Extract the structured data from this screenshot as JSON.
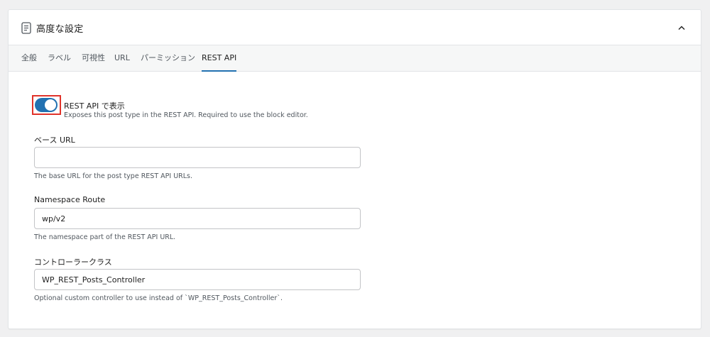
{
  "panel": {
    "title": "高度な設定",
    "header_icon": "document-icon",
    "collapse_icon": "chevron-up-icon"
  },
  "tabs": [
    {
      "label": "全般",
      "active": false
    },
    {
      "label": "ラベル",
      "active": false
    },
    {
      "label": "可視性",
      "active": false
    },
    {
      "label": "URL",
      "active": false
    },
    {
      "label": "パーミッション",
      "active": false
    },
    {
      "label": "REST API",
      "active": true
    }
  ],
  "rest_toggle": {
    "label": "REST API で表示",
    "help": "Exposes this post type in the REST API. Required to use the block editor.",
    "checked": true
  },
  "base_url": {
    "label": "ベース URL",
    "value": "",
    "help": "The base URL for the post type REST API URLs."
  },
  "namespace": {
    "label": "Namespace Route",
    "value": "wp/v2",
    "help": "The namespace part of the REST API URL."
  },
  "controller": {
    "label": "コントローラークラス",
    "value": "WP_REST_Posts_Controller",
    "help": "Optional custom controller to use instead of `WP_REST_Posts_Controller`."
  },
  "colors": {
    "accent": "#2271b1",
    "highlight": "#e0332b"
  }
}
